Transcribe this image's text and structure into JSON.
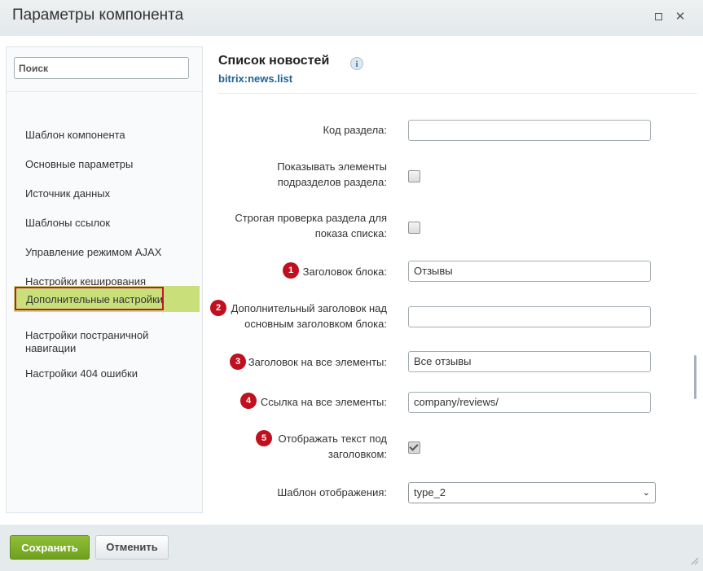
{
  "window": {
    "title": "Параметры компонента",
    "maximize_icon": "maximize-icon",
    "close_icon": "close-icon"
  },
  "sidebar": {
    "search_placeholder": "Поиск",
    "items": [
      {
        "label": "Шаблон компонента"
      },
      {
        "label": "Основные параметры"
      },
      {
        "label": "Источник данных"
      },
      {
        "label": "Шаблоны ссылок"
      },
      {
        "label": "Управление режимом AJAX"
      },
      {
        "label": "Настройки кеширования"
      },
      {
        "label": "Дополнительные настройки",
        "active": true
      },
      {
        "label": "Настройки постраничной навигации"
      },
      {
        "label": "Настройки 404 ошибки"
      }
    ]
  },
  "component": {
    "title": "Список новостей",
    "code": "bitrix:news.list",
    "info_icon": "info-icon"
  },
  "fields": {
    "section_code": {
      "label": "Код раздела:",
      "value": ""
    },
    "show_subsections": {
      "label_line1": "Показывать элементы",
      "label_line2": "подразделов раздела:",
      "checked": false
    },
    "strict_check": {
      "label_line1": "Строгая проверка раздела для",
      "label_line2": "показа списка:",
      "checked": false
    },
    "block_title": {
      "badge": "1",
      "label": "Заголовок блока:",
      "value": "Отзывы"
    },
    "extra_title": {
      "badge": "2",
      "label_line1": "Дополнительный заголовок над",
      "label_line2": "основным заголовком блока:",
      "value": ""
    },
    "all_title": {
      "badge": "3",
      "label": "Заголовок на все элементы:",
      "value": "Все отзывы"
    },
    "all_link": {
      "badge": "4",
      "label": "Ссылка на все элементы:",
      "value": "company/reviews/"
    },
    "show_text": {
      "badge": "5",
      "label_line1": "Отображать текст под",
      "label_line2": "заголовком:",
      "checked": true
    },
    "display_template": {
      "label": "Шаблон отображения:",
      "value": "type_2"
    }
  },
  "footer": {
    "save_label": "Сохранить",
    "cancel_label": "Отменить"
  },
  "colors": {
    "save_green": "#7bab27",
    "badge_red": "#c0101f",
    "active_item": "#c9df7a",
    "highlight_border": "#c3172b",
    "link_blue": "#1a6496"
  }
}
